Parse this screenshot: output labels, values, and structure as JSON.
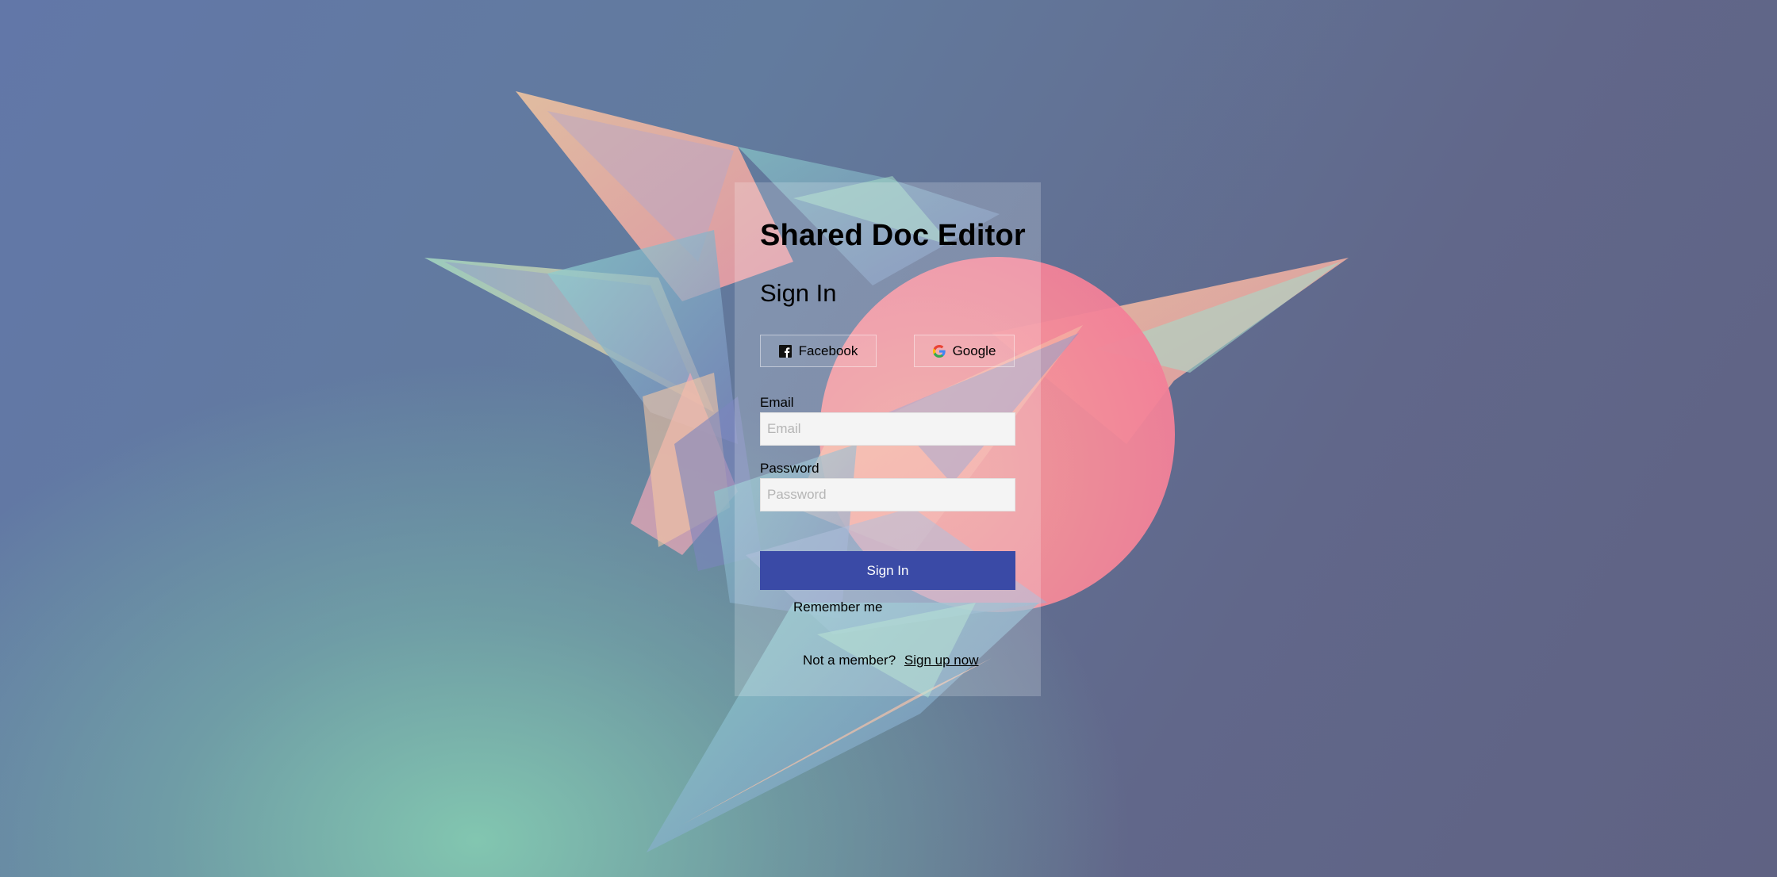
{
  "app": {
    "title": "Shared Doc Editor"
  },
  "form": {
    "title": "Sign In",
    "social": {
      "facebook_label": "Facebook",
      "google_label": "Google"
    },
    "email": {
      "label": "Email",
      "placeholder": "Email"
    },
    "password": {
      "label": "Password",
      "placeholder": "Password"
    },
    "submit_label": "Sign In",
    "remember_label": "Remember me",
    "signup_prompt": "Not a member?",
    "signup_link": "Sign up now"
  },
  "icons": {
    "facebook": "facebook-icon",
    "google": "google-icon"
  },
  "colors": {
    "primary_button": "#3a4aa6",
    "input_bg": "#f4f4f4",
    "accent_circle": "#f27c98"
  }
}
